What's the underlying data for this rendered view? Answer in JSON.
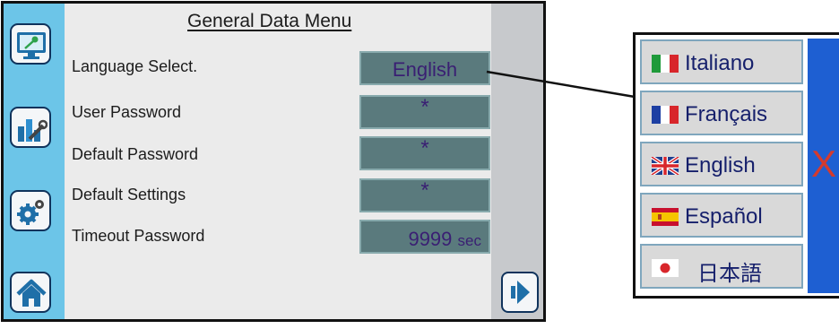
{
  "screen": {
    "title": "General Data Menu",
    "rows": [
      {
        "label": "Language Select.",
        "value": "English"
      },
      {
        "label": "User Password",
        "value": "*"
      },
      {
        "label": "Default Password",
        "value": "*"
      },
      {
        "label": "Default Settings",
        "value": "*"
      },
      {
        "label": "Timeout Password",
        "value": "9999",
        "unit": "sec"
      }
    ]
  },
  "sidebar": {
    "icons": [
      "monitor-key-icon",
      "chart-wrench-icon",
      "gears-icon",
      "home-icon"
    ]
  },
  "nav": {
    "next_icon": "arrow-right-icon"
  },
  "language_popup": {
    "options": [
      {
        "label": "Italiano",
        "flag": "italy-flag-icon"
      },
      {
        "label": "Français",
        "flag": "france-flag-icon"
      },
      {
        "label": "English",
        "flag": "uk-flag-icon"
      },
      {
        "label": "Español",
        "flag": "spain-flag-icon"
      },
      {
        "label": "日本語",
        "flag": "japan-flag-icon"
      }
    ],
    "close_label": "X"
  },
  "colors": {
    "sidebar": "#6cc5e8",
    "field_bg": "#5a7a7d",
    "field_text": "#3a1f73",
    "popup_blue": "#1e5fd2",
    "close_x": "#d43a2e"
  }
}
